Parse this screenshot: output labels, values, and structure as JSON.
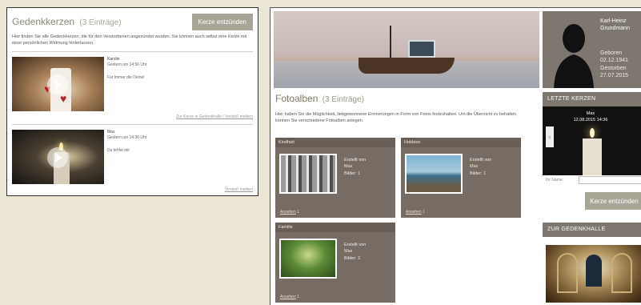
{
  "left_panel": {
    "title": "Gedenkkerzen",
    "count": "(3 Einträge)",
    "light_button": "Kerze entzünden",
    "intro": "Hier finden Sie alle Gedenkkerzen, die für den Verstorbenen angezündet wurden. Sie können auch selbst eine Kerze mit einer persönlichen Widmung hinterlassen.",
    "entries": [
      {
        "name": "Karolin",
        "time": "Gestern um 14:56 Uhr",
        "message": "Für immer die Deine!",
        "link_gallery": "Zur Kerze in Gedenkhalle",
        "separator": "|",
        "link_report": "Verstoß melden"
      },
      {
        "name": "Max",
        "time": "Gestern um 14:36 Uhr",
        "message": "Du fehlst mir",
        "link_report": "Verstoß melden"
      }
    ]
  },
  "profile": {
    "name_line1": "Karl-Heinz",
    "name_line2": "Grundmann",
    "born_label": "Geboren",
    "born_date": "02.12.1941",
    "died_label": "Gestorben",
    "died_date": "27.07.2015"
  },
  "albums_section": {
    "title": "Fotoalben",
    "count": "(3 Einträge)",
    "intro": "Hier haben Sie die Möglichkeit, liebgewonnene Erinnerungen in Form von Fotos festzuhalten. Um die Übersicht zu behalten, können Sie verschiedene Fotoalben anlegen.",
    "albums": [
      {
        "title": "Kindheit",
        "created_label": "Erstellt von",
        "author": "Max",
        "pics_label": "Bilder:",
        "pics": "1",
        "view_label": "Ansehen",
        "views": "1"
      },
      {
        "title": "Hobbies",
        "created_label": "Erstellt von",
        "author": "Max",
        "pics_label": "Bilder:",
        "pics": "1",
        "view_label": "Ansehen",
        "views": "1"
      },
      {
        "title": "Familie",
        "created_label": "Erstellt von",
        "author": "Max",
        "pics_label": "Bilder:",
        "pics": "2",
        "view_label": "Ansehen",
        "views": "1"
      }
    ]
  },
  "sidebar": {
    "last_candles_header": "LETZTE KERZEN",
    "last_candle_name": "Max",
    "last_candle_time": "12.08.2015 14:36",
    "name_label": "Ihr Name:",
    "light_button": "Kerze entzünden",
    "hall_header": "ZUR GEDENKHALLE"
  },
  "colors": {
    "accent": "#a8a596",
    "panel": "#7d776f",
    "album": "#776c64",
    "title": "#7c7a5e"
  }
}
